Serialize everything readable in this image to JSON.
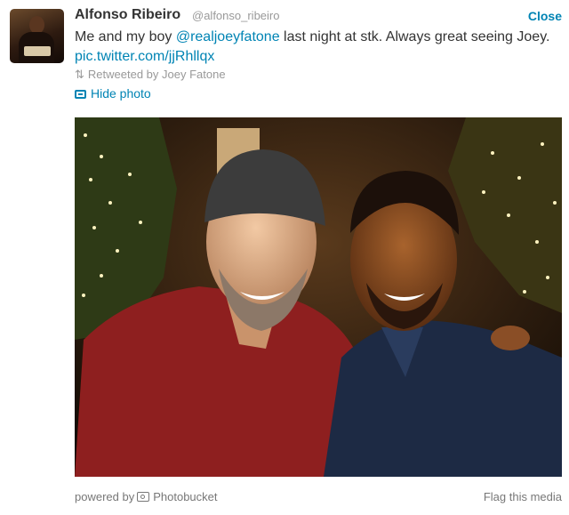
{
  "tweet": {
    "author_name": "Alfonso Ribeiro",
    "author_handle": "@alfonso_ribeiro",
    "close_label": "Close",
    "text_before_mention": "Me and my boy ",
    "mention": "@realjoeyfatone",
    "text_after_mention": " last night at stk. Always great seeing Joey. ",
    "link": "pic.twitter.com/jjRhllqx",
    "retweet_label": "Retweeted by Joey Fatone",
    "hide_photo_label": "Hide photo"
  },
  "media": {
    "powered_by_label": "powered by",
    "provider": "Photobucket",
    "flag_label": "Flag this media"
  },
  "colors": {
    "link": "#0084b4",
    "muted": "#999999",
    "text": "#333333"
  }
}
